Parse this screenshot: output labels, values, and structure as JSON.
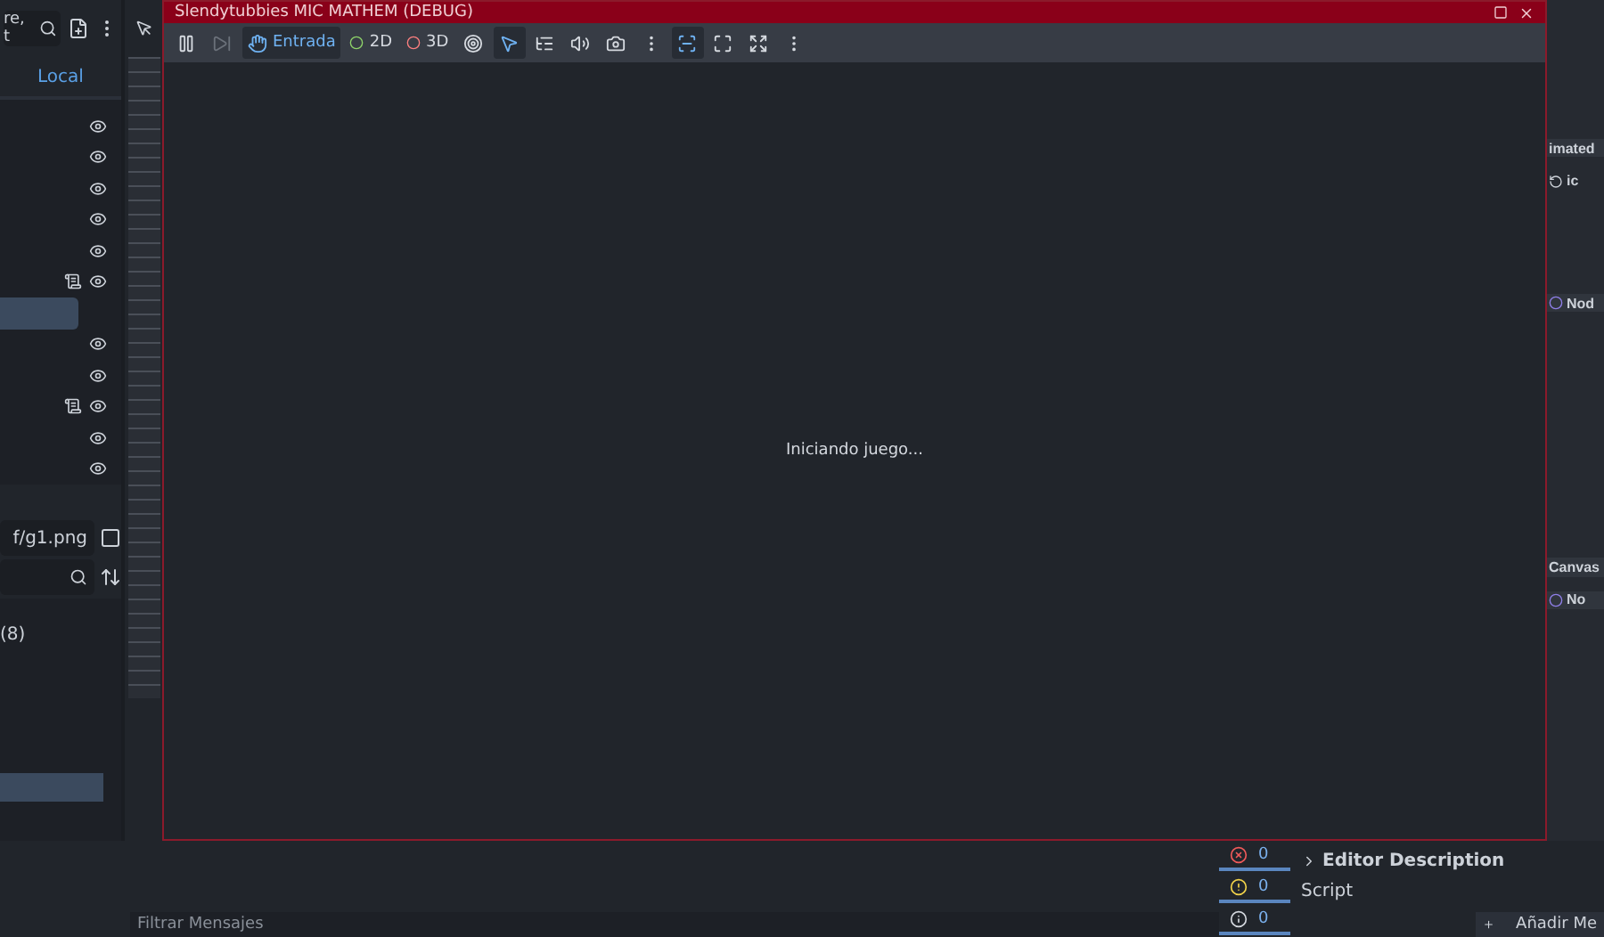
{
  "scene_dock": {
    "search_text": "re, t",
    "tab": "Local",
    "rows": [
      {
        "script": false,
        "selected": false
      },
      {
        "script": false,
        "selected": false
      },
      {
        "script": false,
        "selected": false
      },
      {
        "script": false,
        "selected": false
      },
      {
        "script": false,
        "selected": false
      },
      {
        "script": true,
        "selected": false
      },
      {
        "script": false,
        "selected": true
      },
      {
        "script": false,
        "selected": false
      },
      {
        "script": false,
        "selected": false
      },
      {
        "script": true,
        "selected": false
      },
      {
        "script": false,
        "selected": false
      },
      {
        "script": false,
        "selected": false
      }
    ]
  },
  "filesystem": {
    "path": "f/g1.png",
    "items": [
      {
        "label": "(8)",
        "selected": false
      },
      {
        "selected": true
      }
    ]
  },
  "inspector": {
    "sections": [
      {
        "label": "imated",
        "kind": "plain"
      },
      {
        "label": "ic",
        "kind": "property"
      },
      {
        "label": "Nod",
        "kind": "node"
      },
      {
        "label": "Canvas",
        "kind": "plain"
      },
      {
        "label": "No",
        "kind": "node"
      }
    ]
  },
  "output": {
    "placeholder": "Filtrar Mensajes",
    "counters": [
      {
        "kind": "error",
        "count": "0"
      },
      {
        "kind": "warning",
        "count": "0"
      },
      {
        "kind": "info",
        "count": "0"
      }
    ]
  },
  "inspector_bottom": {
    "section": "Editor Description",
    "expanded": false,
    "field": "Script",
    "button": "Añadir Me"
  },
  "game_window": {
    "title": "Slendytubbies MIC MATHEM (DEBUG)",
    "tools": [
      {
        "kind": "pause",
        "selected": false,
        "disabled": false
      },
      {
        "kind": "next-frame",
        "selected": false,
        "disabled": true
      },
      {
        "kind": "mode",
        "label": "Entrada",
        "selected": true,
        "disabled": false
      },
      {
        "kind": "mode",
        "label": "2D",
        "selected": false,
        "disabled": false,
        "color": "#8fd46a"
      },
      {
        "kind": "mode",
        "label": "3D",
        "selected": false,
        "disabled": false,
        "color": "#fc7f7f"
      },
      {
        "kind": "visibility",
        "selected": false,
        "disabled": false
      },
      {
        "kind": "select",
        "selected": true,
        "disabled": false
      },
      {
        "kind": "list",
        "selected": false,
        "disabled": false
      },
      {
        "kind": "audio",
        "selected": false,
        "disabled": false
      },
      {
        "kind": "camera",
        "selected": false,
        "disabled": false
      },
      {
        "kind": "more",
        "selected": false,
        "disabled": false
      },
      {
        "kind": "embed",
        "selected": true,
        "disabled": false
      },
      {
        "kind": "fit",
        "selected": false,
        "disabled": false
      },
      {
        "kind": "expand",
        "selected": false,
        "disabled": false
      },
      {
        "kind": "more",
        "selected": false,
        "disabled": false
      }
    ],
    "status": "Iniciando juego..."
  }
}
